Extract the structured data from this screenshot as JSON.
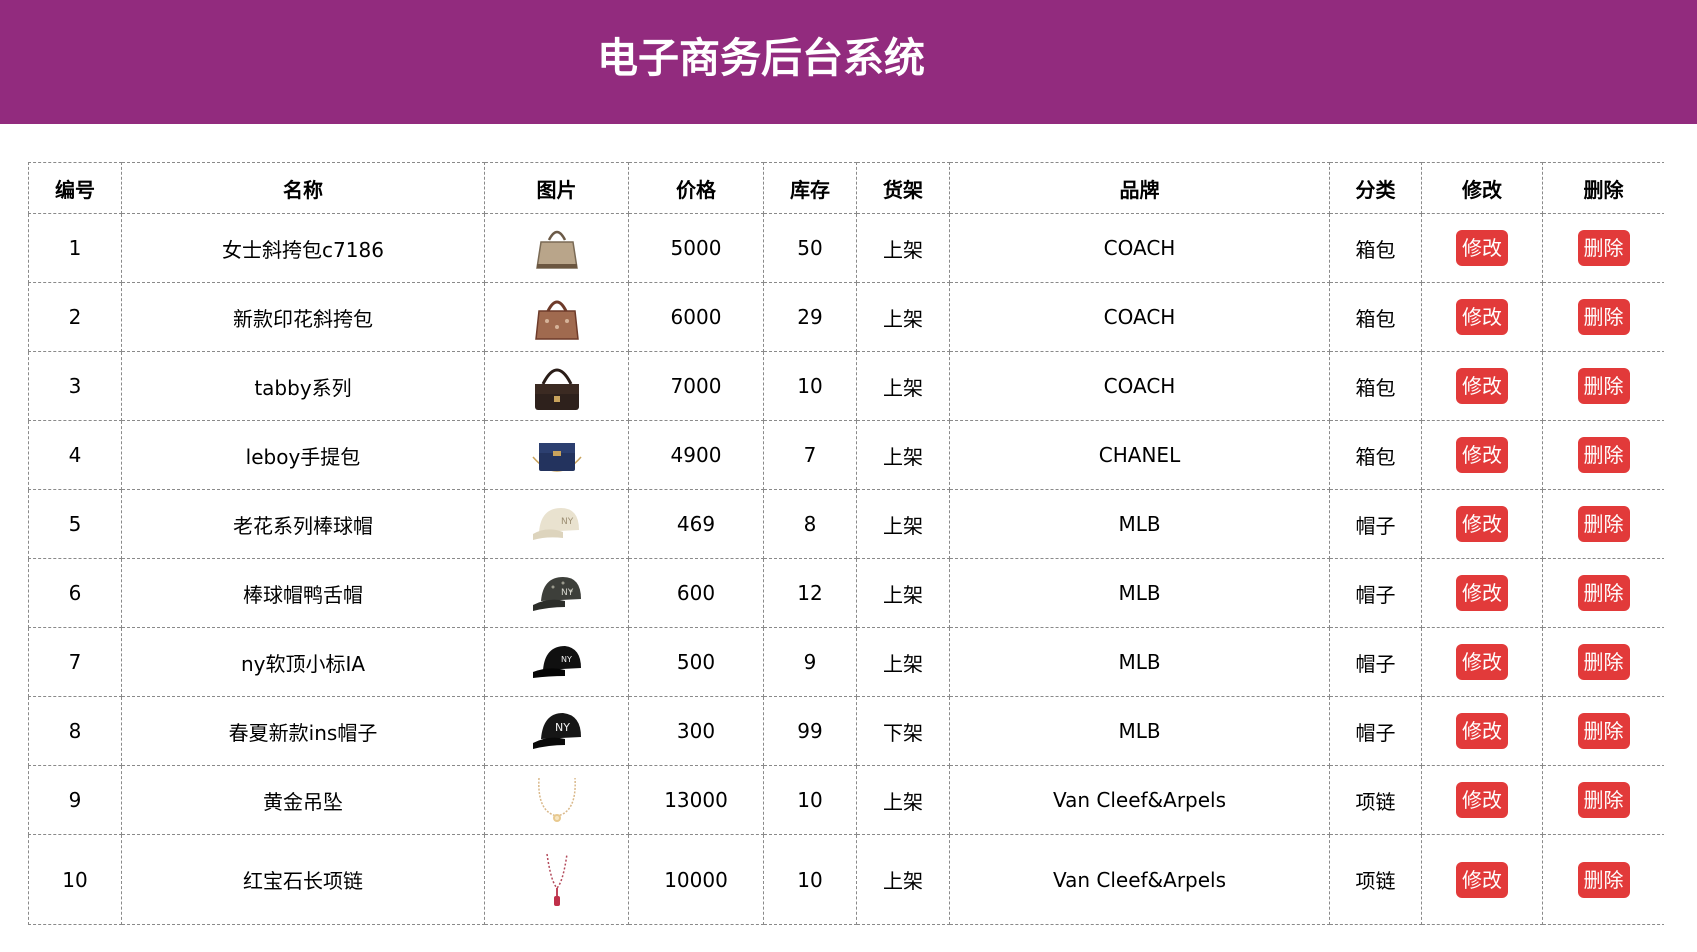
{
  "header": {
    "title": "电子商务后台系统"
  },
  "table": {
    "columns": [
      "编号",
      "名称",
      "图片",
      "价格",
      "库存",
      "货架",
      "品牌",
      "分类",
      "修改",
      "删除"
    ],
    "edit_label": "修改",
    "delete_label": "删除",
    "rows": [
      {
        "id": "1",
        "name": "女士斜挎包c7186",
        "image": "handbag-beige-icon",
        "price": "5000",
        "stock": "50",
        "shelf": "上架",
        "brand": "COACH",
        "category": "箱包"
      },
      {
        "id": "2",
        "name": "新款印花斜挎包",
        "image": "handbag-brown-icon",
        "price": "6000",
        "stock": "29",
        "shelf": "上架",
        "brand": "COACH",
        "category": "箱包"
      },
      {
        "id": "3",
        "name": "tabby系列",
        "image": "handbag-dark-icon",
        "price": "7000",
        "stock": "10",
        "shelf": "上架",
        "brand": "COACH",
        "category": "箱包"
      },
      {
        "id": "4",
        "name": "leboy手提包",
        "image": "handbag-navy-icon",
        "price": "4900",
        "stock": "7",
        "shelf": "上架",
        "brand": "CHANEL",
        "category": "箱包"
      },
      {
        "id": "5",
        "name": "老花系列棒球帽",
        "image": "cap-cream-icon",
        "price": "469",
        "stock": "8",
        "shelf": "上架",
        "brand": "MLB",
        "category": "帽子"
      },
      {
        "id": "6",
        "name": "棒球帽鸭舌帽",
        "image": "cap-pattern-icon",
        "price": "600",
        "stock": "12",
        "shelf": "上架",
        "brand": "MLB",
        "category": "帽子"
      },
      {
        "id": "7",
        "name": "ny软顶小标IA",
        "image": "cap-black-icon",
        "price": "500",
        "stock": "9",
        "shelf": "上架",
        "brand": "MLB",
        "category": "帽子"
      },
      {
        "id": "8",
        "name": "春夏新款ins帽子",
        "image": "cap-black-logo-icon",
        "price": "300",
        "stock": "99",
        "shelf": "下架",
        "brand": "MLB",
        "category": "帽子"
      },
      {
        "id": "9",
        "name": "黄金吊坠",
        "image": "necklace-gold-icon",
        "price": "13000",
        "stock": "10",
        "shelf": "上架",
        "brand": "Van Cleef&Arpels",
        "category": "项链"
      },
      {
        "id": "10",
        "name": "红宝石长项链",
        "image": "necklace-ruby-icon",
        "price": "10000",
        "stock": "10",
        "shelf": "上架",
        "brand": "Van Cleef&Arpels",
        "category": "项链"
      }
    ]
  },
  "colors": {
    "header_bg": "#922b7e",
    "button_bg": "#e23a3a"
  }
}
